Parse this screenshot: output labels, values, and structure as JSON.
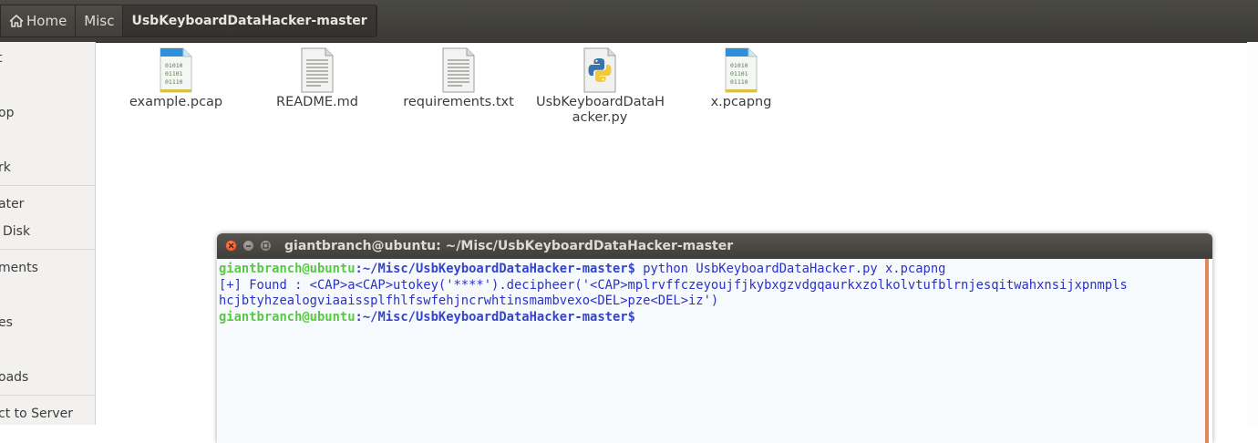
{
  "breadcrumb": {
    "home": "Home",
    "misc": "Misc",
    "current": "UsbKeyboardDataHacker-master"
  },
  "sidebar": {
    "items": [
      {
        "label": "t"
      },
      {
        "label": "op"
      },
      {
        "label": "rk"
      },
      {
        "label": "ater"
      },
      {
        "label": "Disk"
      },
      {
        "label": "ments"
      },
      {
        "label": "es"
      },
      {
        "label": ""
      },
      {
        "label": "oads"
      },
      {
        "label": "ct to Server"
      }
    ]
  },
  "files": [
    {
      "name": "example.pcap",
      "icon": "pcap-file-icon"
    },
    {
      "name": "README.md",
      "icon": "text-file-icon"
    },
    {
      "name": "requirements.txt",
      "icon": "text-file-icon"
    },
    {
      "name_line1": "UsbKeyboardDataH",
      "name_line2": "acker.py",
      "icon": "python-file-icon"
    },
    {
      "name": "x.pcapng",
      "icon": "pcap-file-icon"
    }
  ],
  "terminal": {
    "title": "giantbranch@ubuntu: ~/Misc/UsbKeyboardDataHacker-master",
    "prompt_user": "giantbranch@ubuntu",
    "prompt_path": ":~/Misc/UsbKeyboardDataHacker-master",
    "prompt_symbol": "$",
    "command": " python UsbKeyboardDataHacker.py x.pcapng",
    "output_line1": "[+] Found : <CAP>a<CAP>utokey('****').decipheer('<CAP>mplrvffczeyoujfjkybxgzvdgqaurkxzolkolvtufblrnjesqitwahxnsijxpnmpls",
    "output_line2": "hcjbtyhzealogviaaissplfhlfswfehjncrwhtinsmambvexo<DEL>pze<DEL>iz')"
  },
  "colors": {
    "toolbar": "#3b3a36",
    "prompt_user": "#5ac846",
    "prompt_path": "#3545c9",
    "terminal_text": "#2a31c9",
    "close_button": "#e0542a"
  }
}
